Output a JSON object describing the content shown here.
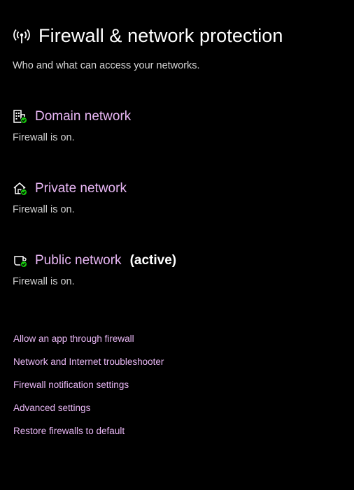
{
  "header": {
    "icon": "broadcast-antenna-icon",
    "title": "Firewall & network protection",
    "subtitle": "Who and what can access your networks."
  },
  "networks": [
    {
      "icon": "domain-building-icon",
      "name": "Domain network",
      "active_label": "",
      "status": "Firewall is on.",
      "status_icon": "check-badge-icon"
    },
    {
      "icon": "private-home-icon",
      "name": "Private network",
      "active_label": "",
      "status": "Firewall is on.",
      "status_icon": "check-badge-icon"
    },
    {
      "icon": "public-coffee-icon",
      "name": "Public network",
      "active_label": "(active)",
      "status": "Firewall is on.",
      "status_icon": "check-badge-icon"
    }
  ],
  "links": [
    "Allow an app through firewall",
    "Network and Internet troubleshooter",
    "Firewall notification settings",
    "Advanced settings",
    "Restore firewalls to default"
  ],
  "colors": {
    "background": "#000000",
    "accent_link": "#e9b7f5",
    "status_ok": "#16c60c",
    "text_primary": "#ffffff",
    "text_secondary": "#cfcfcf"
  }
}
